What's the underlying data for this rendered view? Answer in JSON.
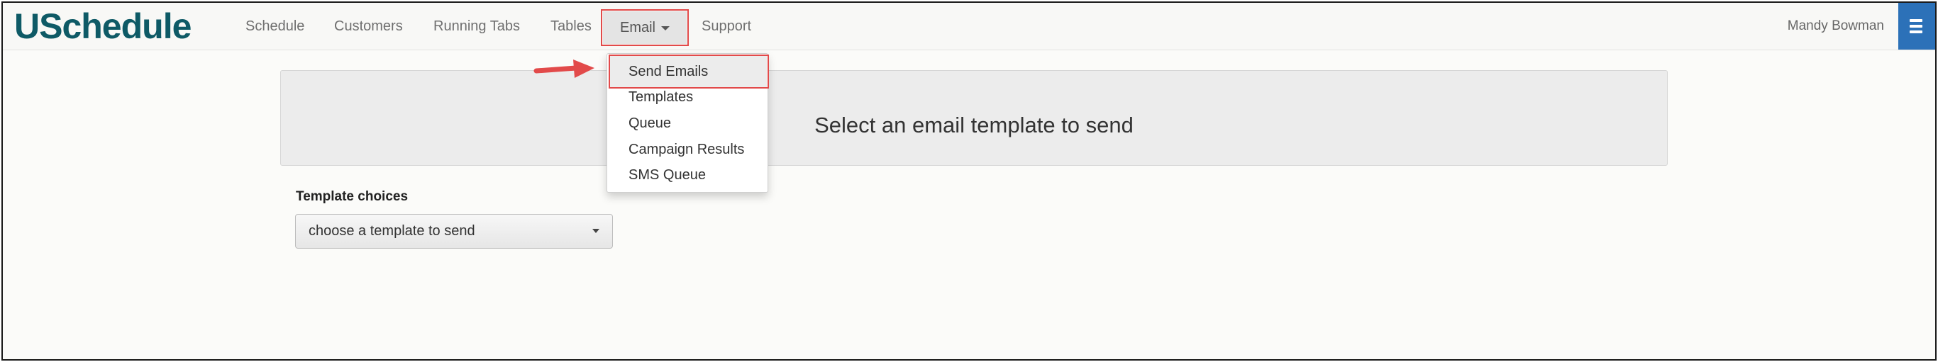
{
  "brand": "USchedule",
  "nav": {
    "schedule": "Schedule",
    "customers": "Customers",
    "running_tabs": "Running Tabs",
    "tables": "Tables",
    "email": "Email",
    "support": "Support"
  },
  "user": {
    "name": "Mandy Bowman"
  },
  "email_menu": {
    "items": [
      "Send Emails",
      "Templates",
      "Queue",
      "Campaign Results",
      "SMS Queue"
    ],
    "highlighted": "Send Emails"
  },
  "panel": {
    "title": "Select an email template to send"
  },
  "form": {
    "label": "Template choices",
    "select_value": "choose a template to send"
  },
  "icons": {
    "menu": "hamburger-icon",
    "callout": "red-arrow-icon",
    "dropdown_caret": "caret-down-icon"
  },
  "colors": {
    "brand": "#0e5a66",
    "menu_button": "#2c71b8",
    "highlight_border": "#e24a4a",
    "arrow": "#e24a4a"
  }
}
